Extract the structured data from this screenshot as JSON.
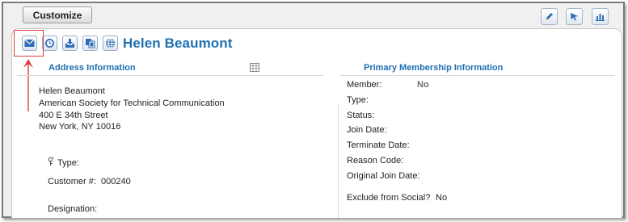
{
  "toolbar": {
    "customize_label": "Customize",
    "icons": [
      "pencil-icon",
      "cursor-icon",
      "bar-chart-icon"
    ]
  },
  "record": {
    "name": "Helen Beaumont",
    "action_icons": [
      "mail-icon",
      "clock-icon",
      "inbox-download-icon",
      "copy-icon",
      "globe-icon"
    ]
  },
  "address": {
    "heading": "Address Information",
    "lines": [
      "Helen Beaumont",
      "American Society for Technical Communication",
      "400 E 34th Street",
      "New York, NY 10016"
    ],
    "type_label": "Type:",
    "customer_label": "Customer #:",
    "customer_value": "000240",
    "designation_label": "Designation:"
  },
  "membership": {
    "heading": "Primary Membership Information",
    "member_label": "Member:",
    "member_value": "No",
    "type_label": "Type:",
    "status_label": "Status:",
    "join_date_label": "Join Date:",
    "terminate_date_label": "Terminate Date:",
    "reason_code_label": "Reason Code:",
    "original_join_label": "Original Join Date:",
    "exclude_label": "Exclude from Social?",
    "exclude_value": "No"
  },
  "colors": {
    "accent": "#1f6fb2",
    "highlight": "#e03c3c"
  }
}
